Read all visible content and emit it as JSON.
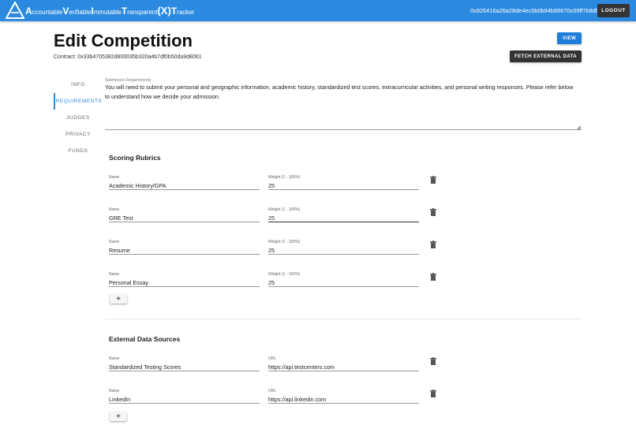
{
  "appbar": {
    "brand_parts": [
      {
        "big": "A",
        "small": "ccountable"
      },
      {
        "big": "V",
        "small": "erifiable"
      },
      {
        "big": "I",
        "small": "mmutable"
      },
      {
        "big": "T",
        "small": "ransparent"
      }
    ],
    "brand_x": "(X)",
    "brand_tail_big": "T",
    "brand_tail_small": "racker",
    "wallet_address": "0x926416a26a28de4ec5b0b94b66670c09ff7b8dbf",
    "logout_label": "LOGOUT",
    "color": "#2b8ae0"
  },
  "header": {
    "title": "Edit Competition",
    "contract": "Contract: 0x33b4705382d800035b320a4b7df0b50da9d8061",
    "view_label": "VIEW",
    "fetch_label": "FETCH EXTERNAL DATA"
  },
  "sidenav": {
    "items": [
      {
        "label": "INFO",
        "active": false
      },
      {
        "label": "REQUIREMENTS",
        "active": true
      },
      {
        "label": "JUDGES",
        "active": false
      },
      {
        "label": "PRIVACY",
        "active": false
      },
      {
        "label": "FUNDS",
        "active": false
      }
    ]
  },
  "requirements": {
    "label": "Submission Requirements",
    "text": "You will need to submit your personal and geographic information, academic history, standardized test scores, extracurricular activities, and personal writing responses. Please refer below to understand how we decide your admission."
  },
  "rubrics": {
    "title": "Scoring Rubrics",
    "name_label": "Name",
    "weight_label": "Weight (1 - 100%)",
    "rows": [
      {
        "name": "Academic History/GPA",
        "weight": "25"
      },
      {
        "name": "GRE Test",
        "weight": "25"
      },
      {
        "name": "Resume",
        "weight": "25"
      },
      {
        "name": "Personal Essay",
        "weight": "25"
      }
    ],
    "add_label": "+"
  },
  "external": {
    "title": "External Data Sources",
    "name_label": "Name",
    "url_label": "URL",
    "rows": [
      {
        "name": "Standardized Testing Scores",
        "url": "https://api.testcenters.com"
      },
      {
        "name": "LinkedIn",
        "url": "https://api.linkedin.com"
      }
    ],
    "add_label": "+"
  }
}
